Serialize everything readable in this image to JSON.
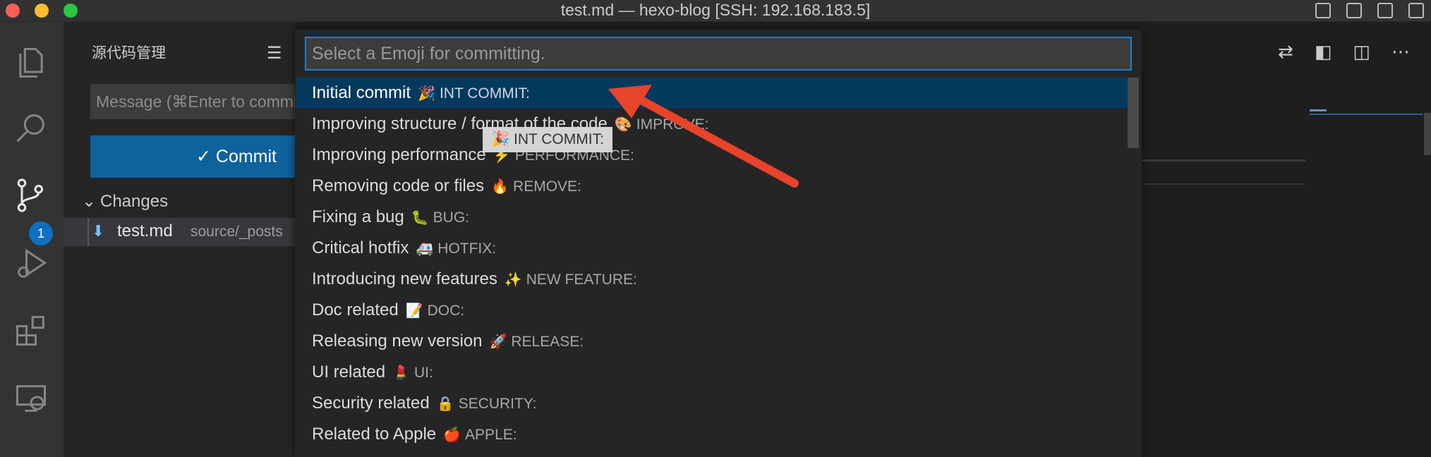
{
  "window": {
    "title": "test.md — hexo-blog [SSH: 192.168.183.5]"
  },
  "activity_bar": {
    "badge_count": "1",
    "items": [
      "explorer-icon",
      "search-icon",
      "source-control-icon",
      "run-debug-icon",
      "extensions-icon",
      "remote-explorer-icon"
    ]
  },
  "sidebar": {
    "title": "源代码管理",
    "message_placeholder": "Message (⌘Enter to commit on 'main')",
    "commit_label": "✓ Commit",
    "changes_label": "Changes",
    "file": {
      "name": "test.md",
      "path": "source/_posts"
    }
  },
  "quick_pick": {
    "placeholder": "Select a Emoji for committing.",
    "items": [
      {
        "label": "Initial commit",
        "emoji": "🎉",
        "code": "INT COMMIT:",
        "selected": true
      },
      {
        "label": "Improving structure / format of the code",
        "emoji": "🎨",
        "code": "IMPROVE:"
      },
      {
        "label": "Improving performance",
        "emoji": "⚡️",
        "code": "PERFORMANCE:"
      },
      {
        "label": "Removing code or files",
        "emoji": "🔥",
        "code": "REMOVE:"
      },
      {
        "label": "Fixing a bug",
        "emoji": "🐛",
        "code": "BUG:"
      },
      {
        "label": "Critical hotfix",
        "emoji": "🚑",
        "code": "HOTFIX:"
      },
      {
        "label": "Introducing new features",
        "emoji": "✨",
        "code": "NEW FEATURE:"
      },
      {
        "label": "Doc related",
        "emoji": "📝",
        "code": "DOC:"
      },
      {
        "label": "Releasing new version",
        "emoji": "🚀",
        "code": "RELEASE:"
      },
      {
        "label": "UI related",
        "emoji": "💄",
        "code": "UI:"
      },
      {
        "label": "Security related",
        "emoji": "🔒",
        "code": "SECURITY:"
      },
      {
        "label": "Related to Apple",
        "emoji": "🍎",
        "code": "APPLE:"
      }
    ]
  },
  "tooltip": {
    "text": "🎉 INT COMMIT:"
  },
  "colors": {
    "accent": "#0e639c",
    "selection": "#04395e",
    "annotation_arrow": "#e8432b"
  }
}
